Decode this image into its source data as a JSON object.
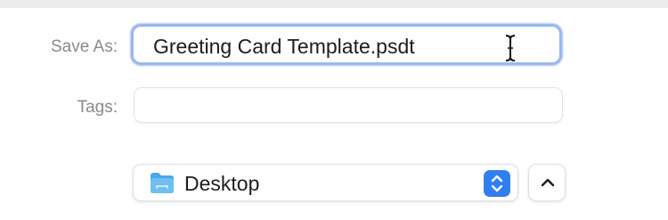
{
  "save_dialog": {
    "save_as_label": "Save As:",
    "file_name_value": "Greeting Card Template.psdt",
    "tags_label": "Tags:",
    "tags_value": "",
    "location": {
      "selected": "Desktop",
      "icon": "folder-icon"
    },
    "expand_icon": "chevron-up-icon"
  },
  "colors": {
    "focus_ring": "#9bb7ee",
    "accent": "#2f7ff0",
    "folder": "#5aaef0"
  }
}
